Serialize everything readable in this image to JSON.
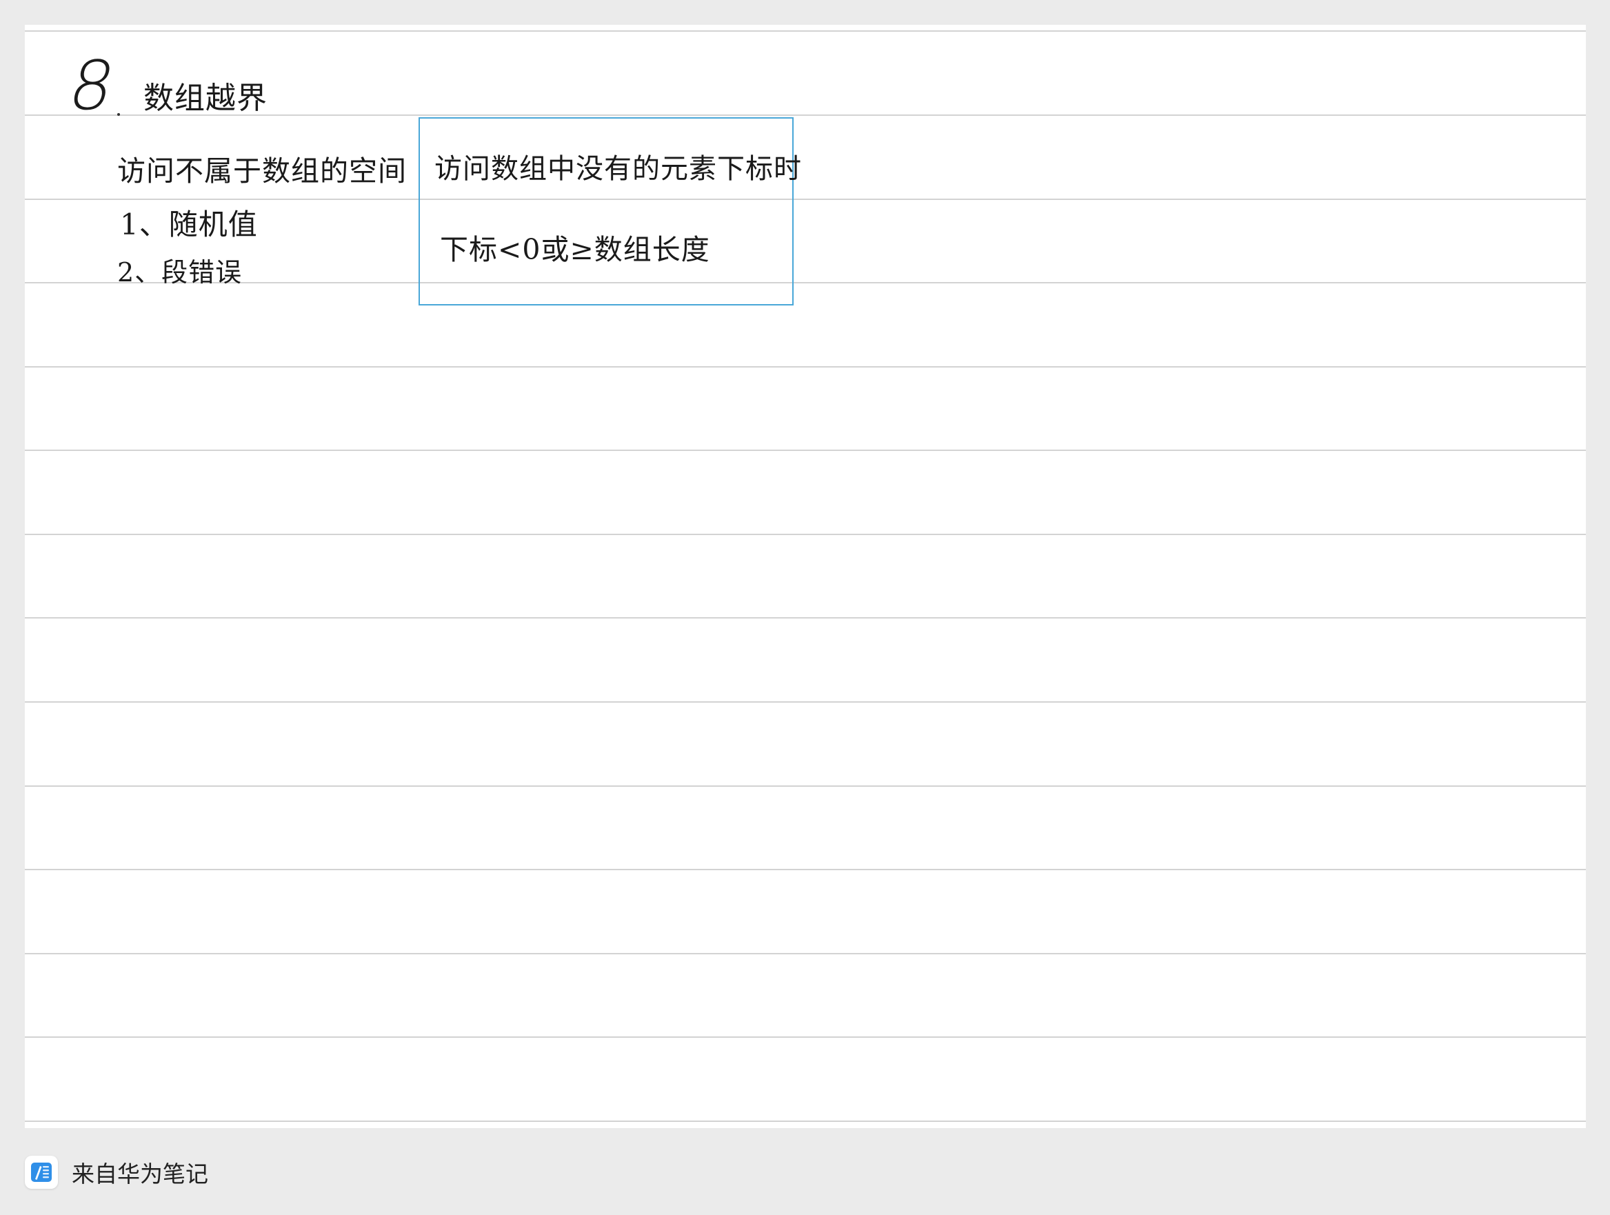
{
  "note": {
    "section_number": "8",
    "title": "数组越界",
    "description": "访问不属于数组的空间",
    "consequences": [
      "1、随机值",
      "2、段错误"
    ],
    "boxed_note": {
      "line1": "访问数组中没有的元素下标时",
      "line2": "下标<0或≥数组长度"
    }
  },
  "footer": {
    "source_label": "来自华为笔记",
    "icon": "huawei-notes-app-icon"
  },
  "colors": {
    "background": "#ebebeb",
    "page": "#ffffff",
    "rule_line": "#d3d3d3",
    "box_border": "#49a7d8",
    "ink": "#1a1a1a",
    "icon_blue": "#2f8fe8"
  }
}
